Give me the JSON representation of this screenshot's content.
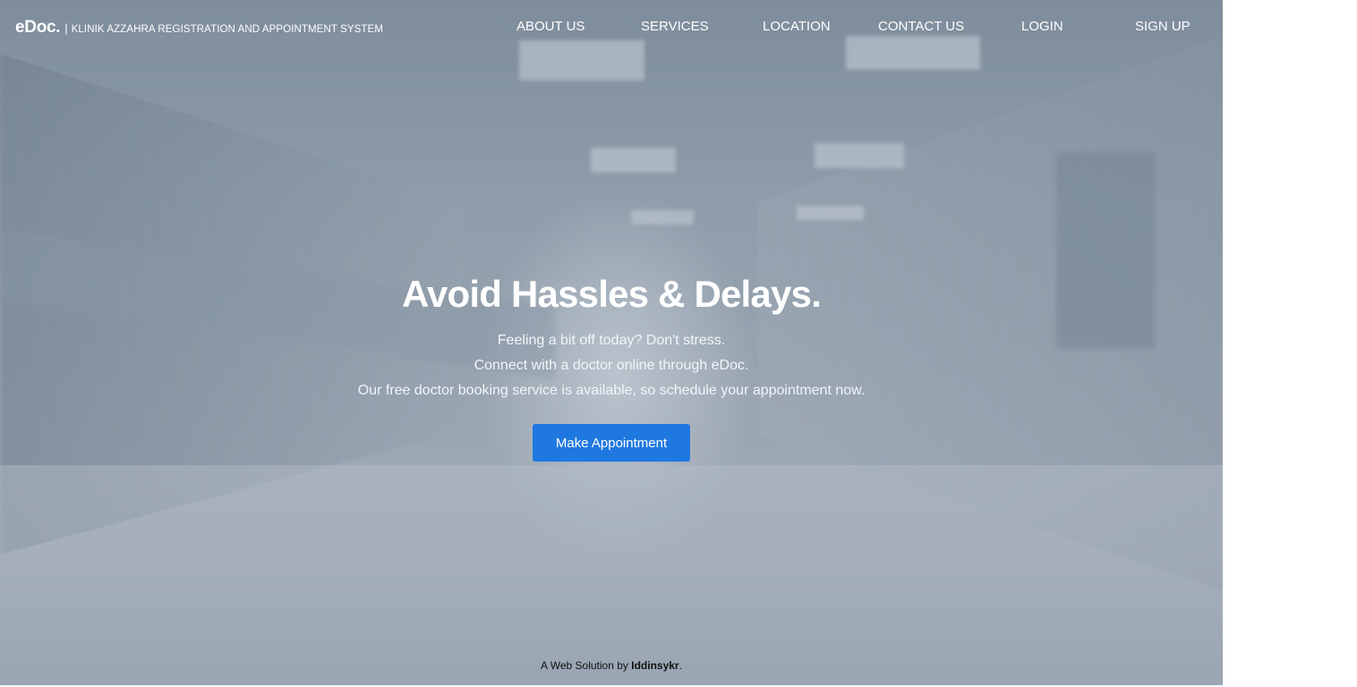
{
  "brand": {
    "name": "eDoc.",
    "separator": "|",
    "tagline": "KLINIK AZZAHRA REGISTRATION AND APPOINTMENT SYSTEM"
  },
  "nav": {
    "items": [
      "ABOUT US",
      "SERVICES",
      "LOCATION",
      "CONTACT US",
      "LOGIN",
      "SIGN UP"
    ]
  },
  "hero": {
    "headline": "Avoid Hassles & Delays.",
    "lines": [
      "Feeling a bit off today? Don't stress.",
      "Connect with a doctor online through eDoc.",
      "Our free doctor booking service is available, so schedule your appointment now."
    ],
    "cta_label": "Make Appointment"
  },
  "footer": {
    "prefix": "A Web Solution by ",
    "author": "Iddinsykr",
    "suffix": "."
  },
  "colors": {
    "accent": "#1f78e0",
    "text_light": "#ffffff",
    "footer_text": "#111111"
  }
}
